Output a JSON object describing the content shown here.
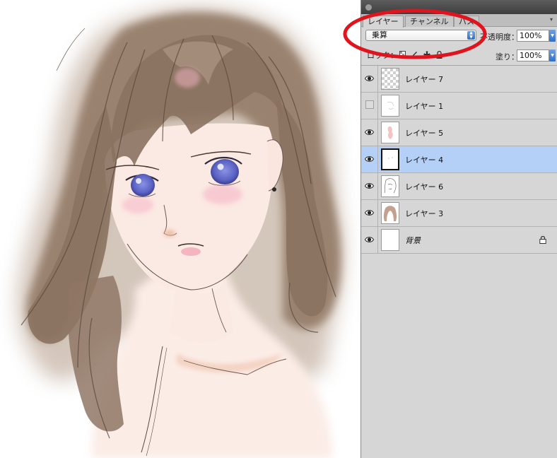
{
  "panel": {
    "tabs": [
      {
        "label": "レイヤー",
        "active": true
      },
      {
        "label": "チャンネル",
        "active": false
      },
      {
        "label": "パス",
        "active": false
      }
    ],
    "blend_mode": "乗算",
    "opacity_label": "不透明度：",
    "opacity_value": "100%",
    "lock_label": "ロック：",
    "fill_label": "塗り：",
    "fill_value": "100%"
  },
  "layers": [
    {
      "name": "レイヤー 7",
      "visible": true,
      "selected": false,
      "thumb": "transparent"
    },
    {
      "name": "レイヤー 1",
      "visible": false,
      "selected": false,
      "thumb": "sketch"
    },
    {
      "name": "レイヤー 5",
      "visible": true,
      "selected": false,
      "thumb": "pink-figure"
    },
    {
      "name": "レイヤー 4",
      "visible": true,
      "selected": true,
      "thumb": "blank"
    },
    {
      "name": "レイヤー 6",
      "visible": true,
      "selected": false,
      "thumb": "line-art"
    },
    {
      "name": "レイヤー 3",
      "visible": true,
      "selected": false,
      "thumb": "hair-color"
    },
    {
      "name": "背景",
      "visible": true,
      "selected": false,
      "thumb": "white",
      "locked": true
    }
  ],
  "colors": {
    "selection": "#b4d0f6",
    "annotation": "#e0141e",
    "hair": "#8a725f",
    "skin": "#fbe9e3",
    "eyes": "#5a62c4"
  }
}
